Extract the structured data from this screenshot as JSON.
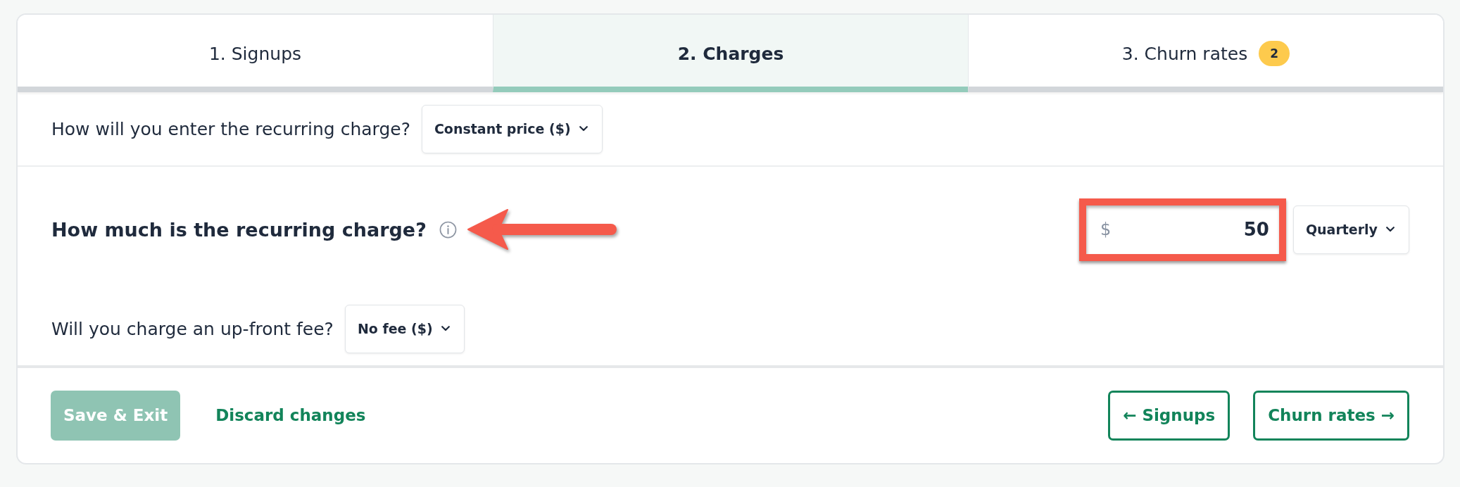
{
  "tabs": [
    {
      "label": "1. Signups",
      "selected": false
    },
    {
      "label": "2. Charges",
      "selected": true
    },
    {
      "label": "3. Churn rates",
      "selected": false,
      "badge": "2"
    }
  ],
  "questions": [
    {
      "kind": "select",
      "label": "How will you enter the recurring charge?",
      "value": "Constant price ($)"
    },
    {
      "kind": "amount",
      "label": "How much is the recurring charge?",
      "info": true,
      "pointer_arrow": true,
      "currency": "$",
      "value": "50",
      "highlighted": true,
      "period": "Quarterly"
    },
    {
      "kind": "select",
      "label": "Will you charge an up-front fee?",
      "value": "No fee ($)"
    }
  ],
  "footer": {
    "save": {
      "label": "Save & Exit",
      "disabled": true
    },
    "discard": {
      "label": "Discard changes"
    },
    "back": {
      "label": "← Signups"
    },
    "next": {
      "label": "Churn rates →"
    }
  }
}
